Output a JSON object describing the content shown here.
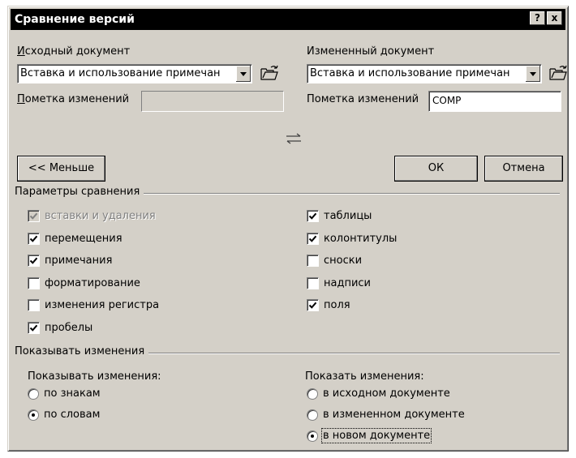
{
  "window": {
    "title": "Сравнение версий",
    "help_label": "?",
    "close_label": "x"
  },
  "original": {
    "label": "Исходный документ",
    "document_value": "Вставка и использование примечан",
    "markup_label": "Пометка изменений",
    "markup_value": ""
  },
  "revised": {
    "label": "Измененный документ",
    "document_value": "Вставка и использование примечан",
    "markup_label": "Пометка изменений",
    "markup_value": "COMP"
  },
  "buttons": {
    "less": "<< Меньше",
    "ok": "ОК",
    "cancel": "Отмена"
  },
  "comparison_settings": {
    "title": "Параметры сравнения",
    "left": [
      {
        "label": "вставки и удаления",
        "checked": true,
        "disabled": true
      },
      {
        "label": "перемещения",
        "checked": true
      },
      {
        "label": "примечания",
        "checked": true
      },
      {
        "label": "форматирование",
        "checked": false
      },
      {
        "label": "изменения регистра",
        "checked": false
      },
      {
        "label": "пробелы",
        "checked": true
      }
    ],
    "right": [
      {
        "label": "таблицы",
        "checked": true
      },
      {
        "label": "колонтитулы",
        "checked": true
      },
      {
        "label": "сноски",
        "checked": false
      },
      {
        "label": "надписи",
        "checked": false
      },
      {
        "label": "поля",
        "checked": true
      }
    ]
  },
  "show_changes": {
    "title": "Показывать изменения",
    "level_label": "Показывать изменения:",
    "level_options": [
      {
        "label": "по знакам",
        "selected": false
      },
      {
        "label": "по словам",
        "selected": true
      }
    ],
    "location_label": "Показать изменения:",
    "location_options": [
      {
        "label": "в исходном документе",
        "selected": false
      },
      {
        "label": "в измененном документе",
        "selected": false
      },
      {
        "label": "в новом документе",
        "selected": true
      }
    ]
  },
  "icons": {
    "browse": "folder-open-icon",
    "swap": "swap-arrows-icon",
    "dropdown": "dropdown-arrow-icon"
  }
}
